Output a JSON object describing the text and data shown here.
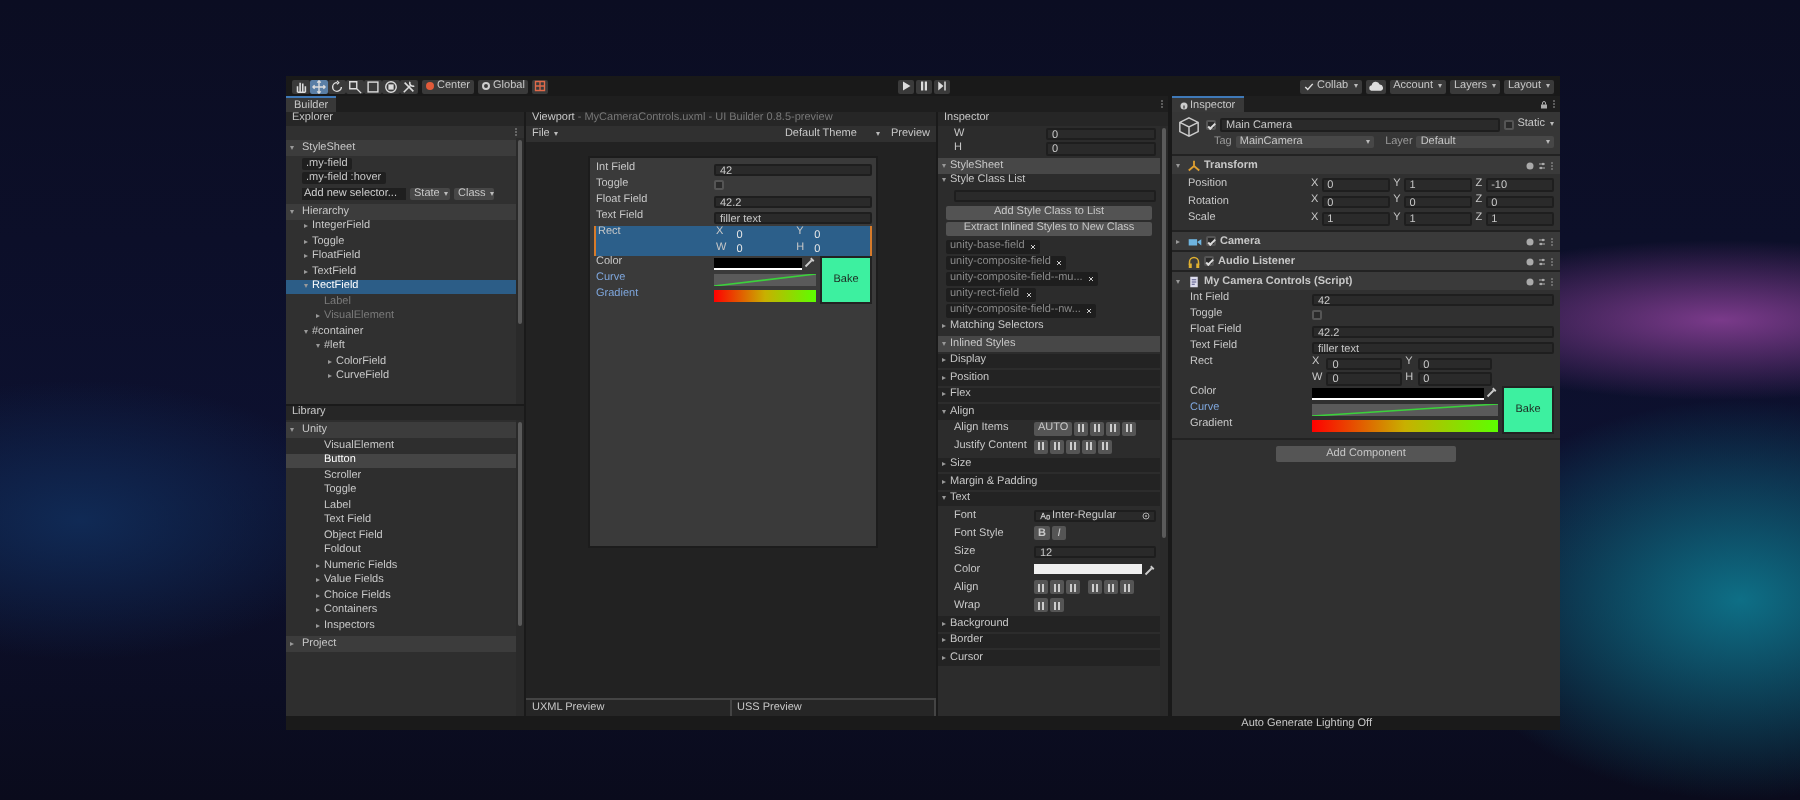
{
  "toolbar": {
    "tools": [
      {
        "selected": false
      },
      {
        "selected": true
      },
      {
        "selected": false
      },
      {
        "selected": false
      },
      {
        "selected": false
      },
      {
        "selected": false
      },
      {
        "selected": false
      }
    ],
    "pivot": "Center",
    "space": "Global",
    "collab": "Collab",
    "account": "Account",
    "layers": "Layers",
    "layout": "Layout"
  },
  "builder": {
    "tab": "Builder",
    "explorer": {
      "title": "Explorer",
      "stylesheet": {
        "label": "StyleSheet",
        "expanded": true,
        "selectors": [
          ".my-field",
          ".my-field :hover"
        ],
        "new_selector": {
          "placeholder": "Add new selector..."
        },
        "state": "State",
        "class": "Class"
      },
      "hierarchy": {
        "label": "Hierarchy",
        "expanded": true,
        "items": [
          {
            "label": "IntegerField",
            "kind": "node",
            "expanded": false,
            "selected": false,
            "dimmed": false
          },
          {
            "label": "Toggle",
            "kind": "node",
            "expanded": false,
            "selected": false,
            "dimmed": false
          },
          {
            "label": "FloatField",
            "kind": "node",
            "expanded": false,
            "selected": false,
            "dimmed": false
          },
          {
            "label": "TextField",
            "kind": "node",
            "expanded": false,
            "selected": false,
            "dimmed": false
          },
          {
            "label": "RectField",
            "kind": "node",
            "expanded": true,
            "selected": true,
            "dimmed": false,
            "children": [
              {
                "label": "Label",
                "kind": "leaf",
                "selected": false,
                "dimmed": true
              },
              {
                "label": "VisualElement",
                "kind": "node",
                "expanded": false,
                "selected": false,
                "dimmed": true
              }
            ]
          },
          {
            "label": "#container",
            "kind": "node",
            "expanded": true,
            "selected": false,
            "dimmed": false,
            "children": [
              {
                "label": "#left",
                "kind": "node",
                "expanded": true,
                "selected": false,
                "dimmed": false,
                "children": [
                  {
                    "label": "ColorField",
                    "kind": "node",
                    "expanded": false,
                    "selected": false,
                    "dimmed": false
                  },
                  {
                    "label": "CurveField",
                    "kind": "node",
                    "expanded": false,
                    "selected": false,
                    "dimmed": false
                  }
                ]
              }
            ]
          }
        ]
      }
    },
    "library": {
      "title": "Library",
      "groups": [
        {
          "label": "Unity",
          "expanded": true,
          "items": [
            {
              "label": "VisualElement",
              "kind": "leaf",
              "selected": false
            },
            {
              "label": "Button",
              "kind": "leaf",
              "selected": true
            },
            {
              "label": "Scroller",
              "kind": "leaf",
              "selected": false
            },
            {
              "label": "Toggle",
              "kind": "leaf",
              "selected": false
            },
            {
              "label": "Label",
              "kind": "leaf",
              "selected": false
            },
            {
              "label": "Text Field",
              "kind": "leaf",
              "selected": false
            },
            {
              "label": "Object Field",
              "kind": "leaf",
              "selected": false
            },
            {
              "label": "Foldout",
              "kind": "leaf",
              "selected": false
            },
            {
              "label": "Numeric Fields",
              "kind": "node",
              "expanded": false,
              "selected": false
            },
            {
              "label": "Value Fields",
              "kind": "node",
              "expanded": false,
              "selected": false
            },
            {
              "label": "Choice Fields",
              "kind": "node",
              "expanded": false,
              "selected": false
            },
            {
              "label": "Containers",
              "kind": "node",
              "expanded": false,
              "selected": false
            },
            {
              "label": "Inspectors",
              "kind": "node",
              "expanded": false,
              "selected": false
            }
          ]
        },
        {
          "label": "Project",
          "expanded": false
        }
      ]
    },
    "viewport": {
      "title": "Viewport",
      "subtitle": "- MyCameraControls.uxml - UI Builder 0.8.5-preview",
      "file_menu": "File",
      "theme": "Default Theme",
      "preview": "Preview",
      "form": {
        "button": "Bake",
        "fields": [
          {
            "label": "Int Field",
            "kind": "int",
            "value": "42",
            "selected": false,
            "overridden": false
          },
          {
            "label": "Toggle",
            "kind": "toggle",
            "checked": false,
            "selected": false,
            "overridden": false
          },
          {
            "label": "Float Field",
            "kind": "float",
            "value": "42.2",
            "selected": false,
            "overridden": false
          },
          {
            "label": "Text Field",
            "kind": "text",
            "value": "filler text",
            "selected": false,
            "overridden": false
          },
          {
            "label": "Rect",
            "kind": "rect",
            "values": [
              {
                "axis": "X",
                "value": "0"
              },
              {
                "axis": "Y",
                "value": "0"
              },
              {
                "axis": "W",
                "value": "0"
              },
              {
                "axis": "H",
                "value": "0"
              }
            ],
            "selected": true,
            "overridden": false
          },
          {
            "label": "Color",
            "kind": "color",
            "selected": false,
            "overridden": false
          },
          {
            "label": "Curve",
            "kind": "curve",
            "selected": false,
            "overridden": true
          },
          {
            "label": "Gradient",
            "kind": "gradient",
            "selected": false,
            "overridden": true
          }
        ]
      },
      "uxml_preview": "UXML Preview",
      "uss_preview": "USS Preview"
    },
    "inspector": {
      "title": "Inspector",
      "rect_rows": [
        {
          "label": "W",
          "value": "0"
        },
        {
          "label": "H",
          "value": "0"
        }
      ],
      "stylesheet": {
        "label": "StyleSheet",
        "expanded": true
      },
      "style_class_list": {
        "label": "Style Class List",
        "expanded": true,
        "add_button": "Add Style Class to List",
        "extract_button": "Extract Inlined Styles to New Class",
        "classes": [
          "unity-base-field",
          "unity-composite-field",
          "unity-composite-field--mu...",
          "unity-rect-field",
          "unity-composite-field--nw..."
        ]
      },
      "matching_selectors": {
        "label": "Matching Selectors",
        "expanded": false
      },
      "inlined_styles": {
        "label": "Inlined Styles",
        "expanded": true,
        "sections": [
          {
            "label": "Display",
            "expanded": false
          },
          {
            "label": "Position",
            "expanded": false
          },
          {
            "label": "Flex",
            "expanded": false
          },
          {
            "label": "Align",
            "expanded": true,
            "rows": [
              {
                "label": "Align Items",
                "kind": "align_items",
                "auto": "AUTO"
              },
              {
                "label": "Justify Content",
                "kind": "justify"
              }
            ]
          },
          {
            "label": "Size",
            "expanded": false
          },
          {
            "label": "Margin & Padding",
            "expanded": false
          },
          {
            "label": "Text",
            "expanded": true,
            "rows": [
              {
                "label": "Font",
                "kind": "font",
                "value": "Inter-Regular"
              },
              {
                "label": "Font Style",
                "kind": "font_style",
                "options": [
                  "B",
                  "I"
                ]
              },
              {
                "label": "Size",
                "kind": "number",
                "value": "12"
              },
              {
                "label": "Color",
                "kind": "color"
              },
              {
                "label": "Align",
                "kind": "text_align"
              },
              {
                "label": "Wrap",
                "kind": "wrap"
              }
            ]
          },
          {
            "label": "Background",
            "expanded": false
          },
          {
            "label": "Border",
            "expanded": false
          },
          {
            "label": "Cursor",
            "expanded": false
          }
        ]
      }
    }
  },
  "unity_inspector": {
    "tab": "Inspector",
    "object": {
      "active": true,
      "name": "Main Camera",
      "static": false,
      "static_label": "Static",
      "tag_label": "Tag",
      "tag": "MainCamera",
      "layer_label": "Layer",
      "layer": "Default"
    },
    "components": [
      {
        "kind": "transform",
        "name": "Transform",
        "expanded": true,
        "rows": [
          {
            "label": "Position",
            "values": [
              {
                "axis": "X",
                "value": "0"
              },
              {
                "axis": "Y",
                "value": "1"
              },
              {
                "axis": "Z",
                "value": "-10"
              }
            ]
          },
          {
            "label": "Rotation",
            "values": [
              {
                "axis": "X",
                "value": "0"
              },
              {
                "axis": "Y",
                "value": "0"
              },
              {
                "axis": "Z",
                "value": "0"
              }
            ]
          },
          {
            "label": "Scale",
            "values": [
              {
                "axis": "X",
                "value": "1"
              },
              {
                "axis": "Y",
                "value": "1"
              },
              {
                "axis": "Z",
                "value": "1"
              }
            ]
          }
        ]
      },
      {
        "kind": "camera",
        "name": "Camera",
        "expanded": false,
        "enabled": true
      },
      {
        "kind": "audio",
        "name": "Audio Listener",
        "enabled": true
      },
      {
        "kind": "script",
        "name": "My Camera Controls (Script)",
        "expanded": true,
        "form": {
          "button": "Bake",
          "fields": [
            {
              "label": "Int Field",
              "kind": "int",
              "value": "42",
              "overridden": false
            },
            {
              "label": "Toggle",
              "kind": "toggle",
              "checked": false,
              "overridden": false
            },
            {
              "label": "Float Field",
              "kind": "float",
              "value": "42.2",
              "overridden": false
            },
            {
              "label": "Text Field",
              "kind": "text",
              "value": "filler text",
              "overridden": false
            },
            {
              "label": "Rect",
              "kind": "rect",
              "values": [
                {
                  "axis": "X",
                  "value": "0"
                },
                {
                  "axis": "Y",
                  "value": "0"
                },
                {
                  "axis": "W",
                  "value": "0"
                },
                {
                  "axis": "H",
                  "value": "0"
                }
              ],
              "overridden": false
            },
            {
              "label": "Color",
              "kind": "color",
              "overridden": false
            },
            {
              "label": "Curve",
              "kind": "curve",
              "overridden": true
            },
            {
              "label": "Gradient",
              "kind": "gradient",
              "overridden": false
            }
          ]
        }
      }
    ],
    "add_component": "Add Component"
  },
  "status_bar": "Auto Generate Lighting Off"
}
